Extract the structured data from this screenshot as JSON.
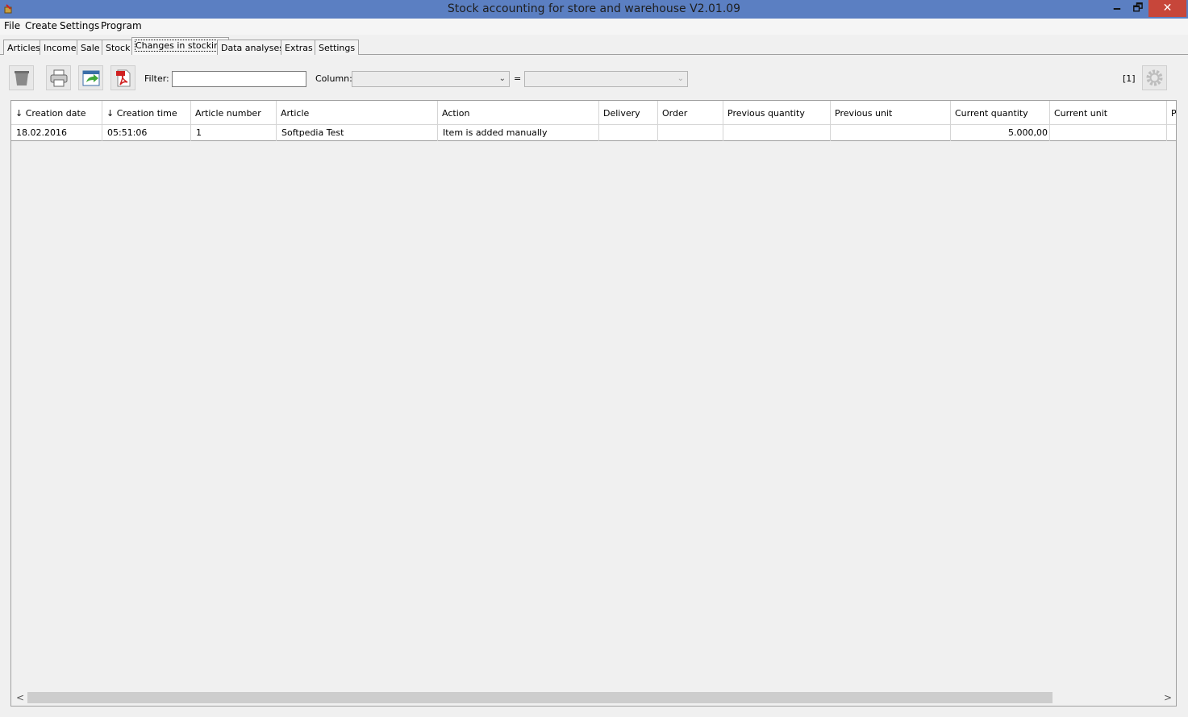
{
  "window": {
    "title": "Stock accounting for store and warehouse V2.01.09",
    "min": "🗕",
    "max": "🗗",
    "close": "✕"
  },
  "menu": [
    "File",
    "Create",
    "Settings",
    "Program"
  ],
  "tabs": [
    "Articles",
    "Income",
    "Sale",
    "Stock",
    "Changes in stocking",
    "Data analyses",
    "Extras",
    "Settings"
  ],
  "active_tab": "Changes in stocking",
  "toolbar": {
    "filter_label": "Filter:",
    "filter_value": "",
    "column_label": "Column:",
    "column_value": "",
    "equals": "=",
    "value_value": "",
    "page_count": "[1]",
    "icons": [
      "delete-icon",
      "print-icon",
      "export-icon",
      "pdf-icon",
      "settings-gear-icon"
    ]
  },
  "table": {
    "headers": [
      "↓ Creation date",
      "↓ Creation time",
      "Article number",
      "Article",
      "Action",
      "Delivery",
      "Order",
      "Previous quantity",
      "Previous unit",
      "Current quantity",
      "Current unit",
      "P"
    ],
    "rows": [
      [
        "18.02.2016",
        "05:51:06",
        "1",
        "Softpedia Test",
        "Item is added manually",
        "",
        "",
        "",
        "",
        "5.000,00",
        "",
        ""
      ]
    ]
  },
  "scrollbar": {
    "left": "<",
    "right": ">"
  }
}
